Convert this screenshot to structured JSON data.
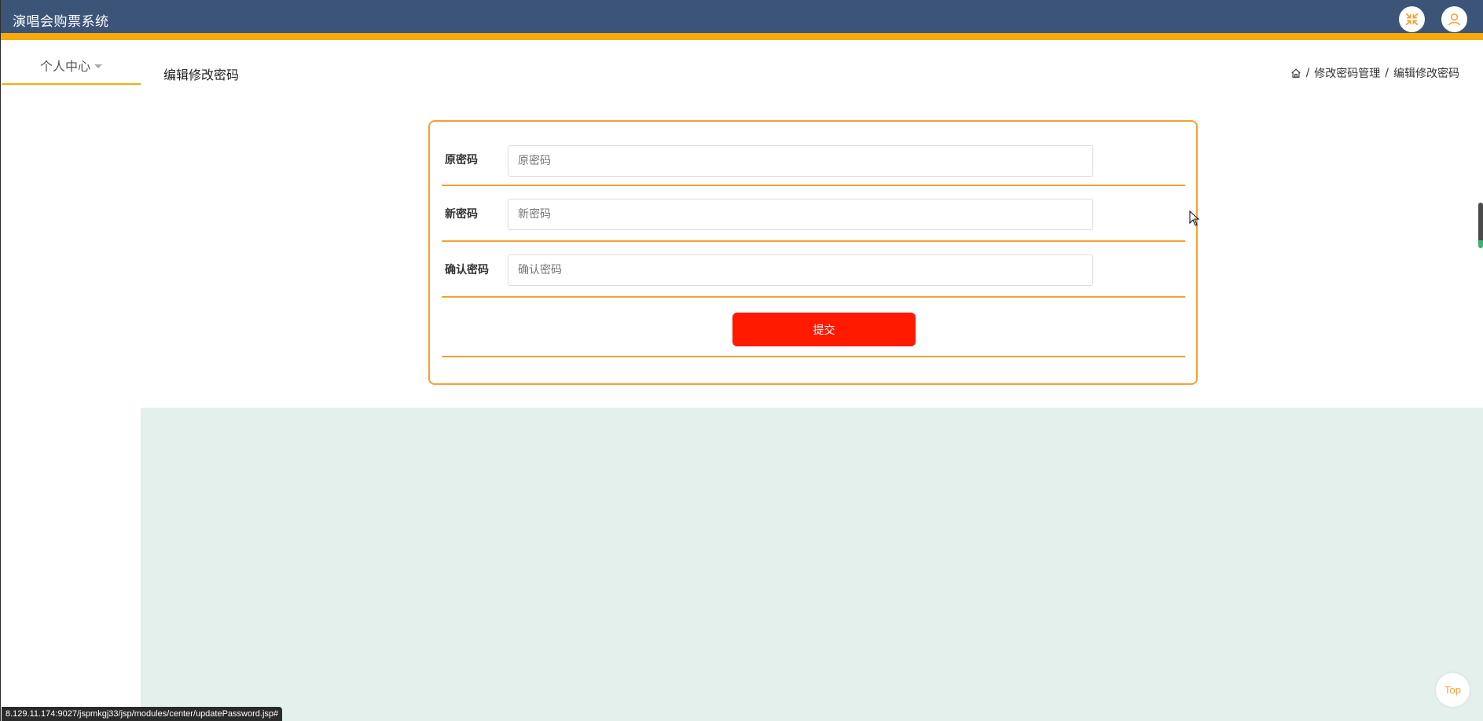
{
  "app": {
    "title": "演唱会购票系统"
  },
  "header": {
    "fullscreen_icon": "fullscreen-exit-icon",
    "user_icon": "user-icon",
    "accent": "#f5a90c",
    "bg": "#3c5478"
  },
  "sidebar": {
    "items": [
      {
        "label": "个人中心"
      }
    ]
  },
  "main": {
    "title": "编辑修改密码",
    "breadcrumb": [
      {
        "label": "修改密码管理"
      },
      {
        "label": "编辑修改密码"
      }
    ],
    "breadcrumb_separator": "/"
  },
  "form": {
    "fields": [
      {
        "label": "原密码",
        "value": "",
        "placeholder": "原密码"
      },
      {
        "label": "新密码",
        "value": "",
        "placeholder": "新密码"
      },
      {
        "label": "确认密码",
        "value": "",
        "placeholder": "确认密码"
      }
    ],
    "submit_label": "提交",
    "submit_color": "#ff1a00",
    "border_color": "#f5a033"
  },
  "footer": {
    "top_label": "Top"
  },
  "status_bar": {
    "url": "8.129.11.174:9027/jspmkgj33/jsp/modules/center/updatePassword.jsp#"
  }
}
